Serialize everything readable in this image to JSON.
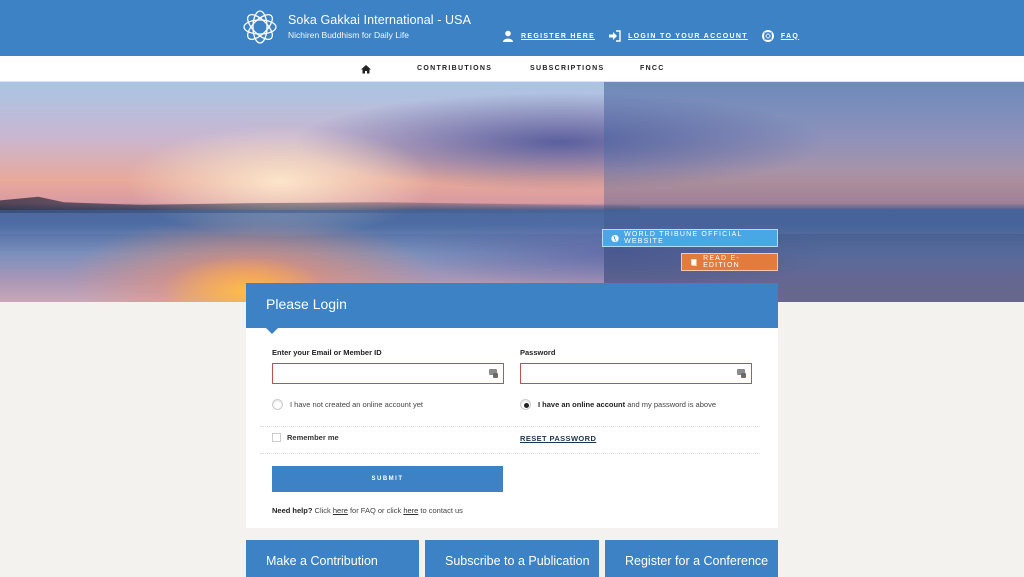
{
  "brand": {
    "title": "Soka Gakkai International - USA",
    "subtitle": "Nichiren Buddhism for Daily Life",
    "logo_icon": "interlocking-rings-logo",
    "color_primary": "#3c82c4"
  },
  "top_links": [
    {
      "label": "Register Here",
      "icon": "user-icon"
    },
    {
      "label": "Login to Your Account",
      "icon": "sign-in-icon"
    },
    {
      "label": "FAQ",
      "icon": "life-ring-icon"
    }
  ],
  "nav": {
    "home_icon": "home-icon",
    "items": [
      "Contributions",
      "Subscriptions",
      "FNCC"
    ]
  },
  "hero": {
    "buttons": [
      {
        "label": "World Tribune Official Website",
        "icon": "globe-icon",
        "color": "#4aa7e6"
      },
      {
        "label": "Read E-Edition",
        "icon": "book-icon",
        "color": "#e27b3c"
      }
    ]
  },
  "login": {
    "title": "Please Login",
    "email_label": "Enter your Email or Member ID",
    "email_value": "",
    "password_label": "Password",
    "password_value": "",
    "radio_no_account": "I have not created an online account yet",
    "radio_has_account_bold": "I have an online account",
    "radio_has_account_rest": " and my password is above",
    "selected_radio": "has_account",
    "remember_label": "Remember me",
    "remember_checked": false,
    "reset_label": "RESET PASSWORD",
    "submit_label": "Submit",
    "help": {
      "bold": "Need help?",
      "part1": " Click ",
      "link1": "here",
      "part2": " for FAQ or click ",
      "link2": "here",
      "part3": " to contact us"
    }
  },
  "tiles": [
    "Make a Contribution",
    "Subscribe to a Publication",
    "Register for a Conference"
  ]
}
